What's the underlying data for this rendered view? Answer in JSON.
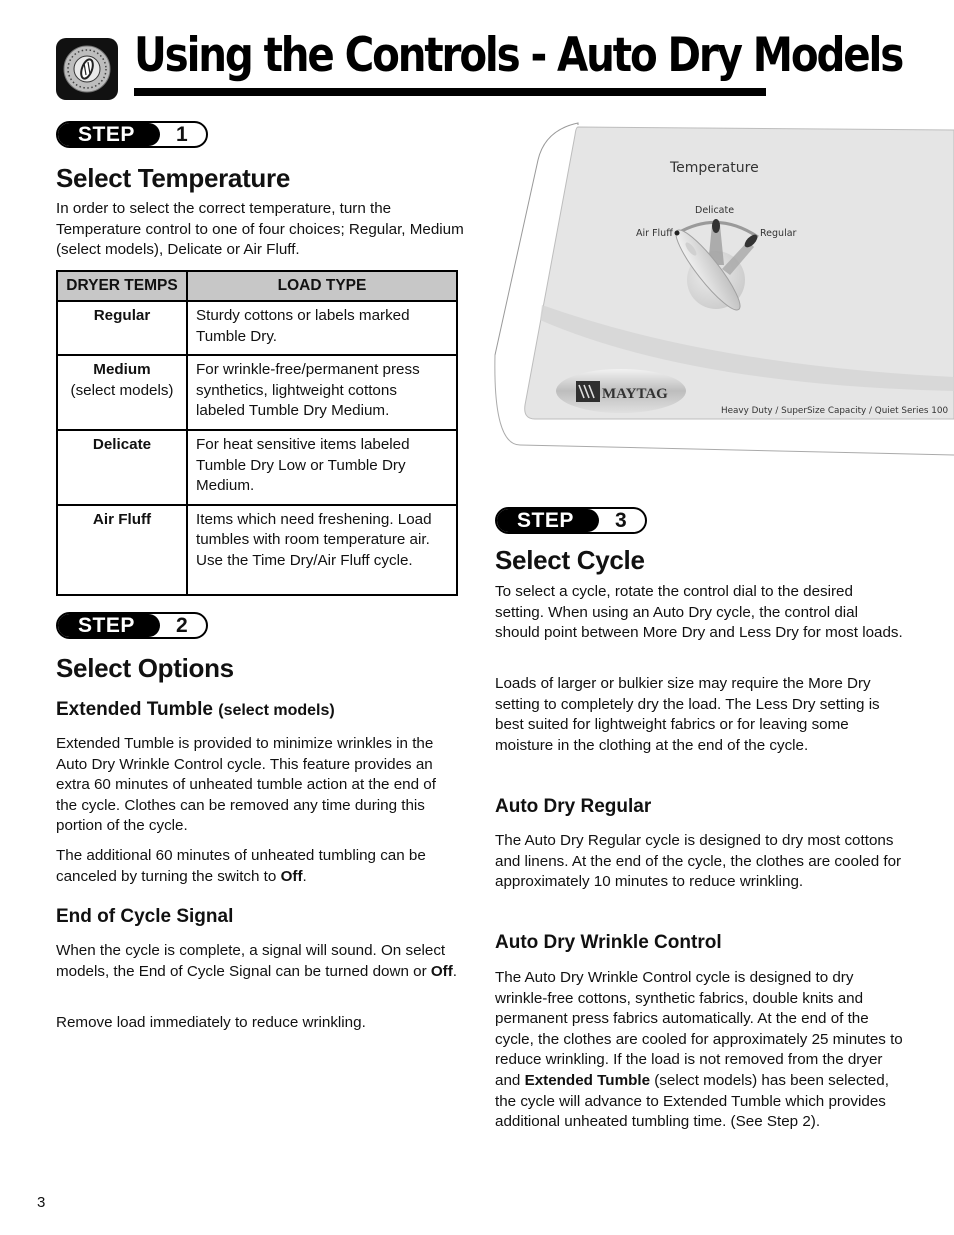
{
  "header": {
    "icon": "dryer-dial-icon",
    "title": "Using the Controls - Auto Dry Models"
  },
  "step1": {
    "step_word": "STEP",
    "step_number": "1",
    "title": "Select Temperature",
    "intro": "In order to select the correct temperature, turn the Temperature control to one of four choices; Regular, Medium (select models), Delicate or Air Fluff.",
    "table": {
      "headers": [
        "DRYER TEMPS",
        "LOAD TYPE"
      ],
      "rows": [
        {
          "temp": "Regular",
          "note": "",
          "load": "Sturdy cottons or labels marked Tumble Dry."
        },
        {
          "temp": "Medium",
          "note": "(select models)",
          "load": "For wrinkle-free/permanent press synthetics, lightweight cottons labeled Tumble Dry Medium."
        },
        {
          "temp": "Delicate",
          "note": "",
          "load": "For heat sensitive items labeled Tumble Dry Low or Tumble Dry Medium."
        },
        {
          "temp": "Air Fluff",
          "note": "",
          "load": "Items which need freshening. Load tumbles with room temperature air. Use the Time Dry/Air Fluff cycle."
        }
      ]
    }
  },
  "panel_illustration": {
    "control_label": "Temperature",
    "dial_positions": [
      "Air Fluff",
      "Delicate",
      "Regular"
    ],
    "selected_position": "Air Fluff",
    "brand": "MAYTAG",
    "model_text": "Heavy Duty / SuperSize Capacity / Quiet Series 100"
  },
  "step2": {
    "step_word": "STEP",
    "step_number": "2",
    "title": "Select Options",
    "extended_tumble": {
      "heading": "Extended Tumble",
      "heading_note": "(select models)",
      "p1": "Extended Tumble is provided to minimize wrinkles in the Auto Dry Wrinkle Control cycle. This feature provides an extra 60 minutes of unheated tumble action at the end of the cycle. Clothes can be removed any time during this portion of the cycle.",
      "p2_before": "The additional 60 minutes of unheated tumbling can be canceled by turning the switch to ",
      "p2_bold": "Off",
      "p2_after": "."
    },
    "end_signal": {
      "heading": "End of Cycle Signal",
      "p1_before": "When the cycle is complete, a signal will sound. On select models, the End of Cycle Signal can be turned down or ",
      "p1_bold": "Off",
      "p1_after": ".",
      "p2": "Remove load immediately to reduce wrinkling."
    }
  },
  "step3": {
    "step_word": "STEP",
    "step_number": "3",
    "title": "Select Cycle",
    "p1": "To select a cycle, rotate the control dial to the desired setting. When using an Auto Dry cycle, the control dial should point between More Dry and Less Dry for most loads.",
    "p2": "Loads of larger or bulkier size may require the More Dry setting to completely dry the load. The Less Dry setting is best suited for lightweight fabrics or for leaving some moisture in the clothing at the end of the cycle.",
    "auto_dry_regular": {
      "heading": "Auto Dry Regular",
      "text": "The Auto Dry Regular cycle is designed to dry most cottons and linens. At the end of the cycle, the clothes are cooled for approximately 10 minutes to reduce wrinkling."
    },
    "auto_dry_wrinkle": {
      "heading": "Auto Dry Wrinkle Control",
      "text_before": "The Auto Dry Wrinkle Control cycle is designed to dry wrinkle-free cottons, synthetic fabrics, double knits and permanent press fabrics automatically. At the end of the cycle, the clothes are cooled for approximately 25 minutes to reduce wrinkling. If the load is not removed from the dryer and ",
      "text_bold": "Extended Tumble",
      "text_after": " (select models) has been selected, the cycle will advance to Extended Tumble which provides additional unheated tumbling time. (See Step 2)."
    }
  },
  "footer": {
    "page_number": "3"
  }
}
